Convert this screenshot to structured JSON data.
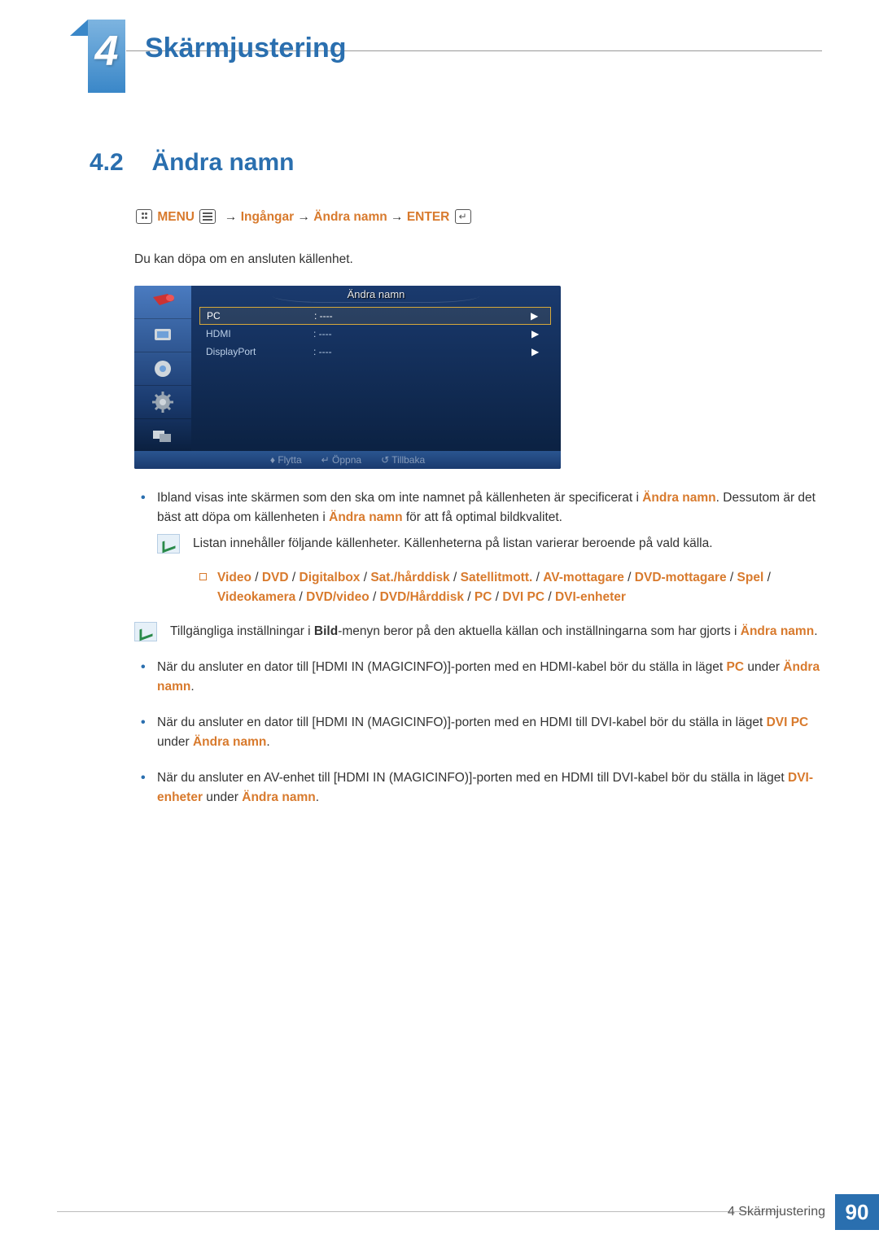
{
  "chapter": {
    "number": "4",
    "title": "Skärmjustering"
  },
  "section": {
    "number": "4.2",
    "title": "Ändra namn"
  },
  "menu_path": {
    "menu": "MENU",
    "step1": "Ingångar",
    "step2": "Ändra namn",
    "enter": "ENTER",
    "arrow": "→"
  },
  "intro": "Du kan döpa om en ansluten källenhet.",
  "osd": {
    "title": "Ändra namn",
    "rows": [
      {
        "name": "PC",
        "value": ": ----",
        "selected": true
      },
      {
        "name": "HDMI",
        "value": ": ----",
        "selected": false
      },
      {
        "name": "DisplayPort",
        "value": ": ----",
        "selected": false
      }
    ],
    "foot": {
      "move": "Flytta",
      "open": "Öppna",
      "back": "Tillbaka"
    }
  },
  "bullets": {
    "item1_a": "Ibland visas inte skärmen som den ska om inte namnet på källenheten är specificerat i ",
    "item1_b": "Ändra namn",
    "item1_c": ". Dessutom är det bäst att döpa om källenheten i ",
    "item1_d": "Ändra namn",
    "item1_e": " för att få optimal bildkvalitet.",
    "note1": "Listan innehåller följande källenheter. Källenheterna på listan varierar beroende på vald källa.",
    "sources_prefix": "",
    "sources": [
      "Video",
      "DVD",
      "Digitalbox",
      "Sat./hårddisk",
      "Satellitmott.",
      "AV-mottagare",
      "DVD-mottagare",
      "Spel",
      "Videokamera",
      "DVD/video",
      "DVD/Hårddisk",
      "PC",
      "DVI PC",
      "DVI-enheter"
    ],
    "note2_a": "Tillgängliga inställningar i ",
    "note2_b": "Bild",
    "note2_c": "-menyn beror på den aktuella källan och inställningarna som har gjorts i ",
    "note2_d": "Ändra namn",
    "note2_e": ".",
    "item2_a": "När du ansluter en dator till [HDMI IN (MAGICINFO)]-porten med en HDMI-kabel bör du ställa in läget ",
    "item2_b": "PC",
    "item2_c": " under ",
    "item2_d": "Ändra namn",
    "item2_e": ".",
    "item3_a": "När du ansluter en dator till [HDMI IN (MAGICINFO)]-porten med en HDMI till DVI-kabel bör du ställa in läget ",
    "item3_b": "DVI PC",
    "item3_c": " under ",
    "item3_d": "Ändra namn",
    "item3_e": ".",
    "item4_a": "När du ansluter en AV-enhet till [HDMI IN (MAGICINFO)]-porten med en HDMI till DVI-kabel bör du ställa in läget ",
    "item4_b": "DVI-enheter",
    "item4_c": " under ",
    "item4_d": "Ändra namn",
    "item4_e": "."
  },
  "footer": {
    "label": "4 Skärmjustering",
    "page": "90"
  },
  "sep": " / "
}
